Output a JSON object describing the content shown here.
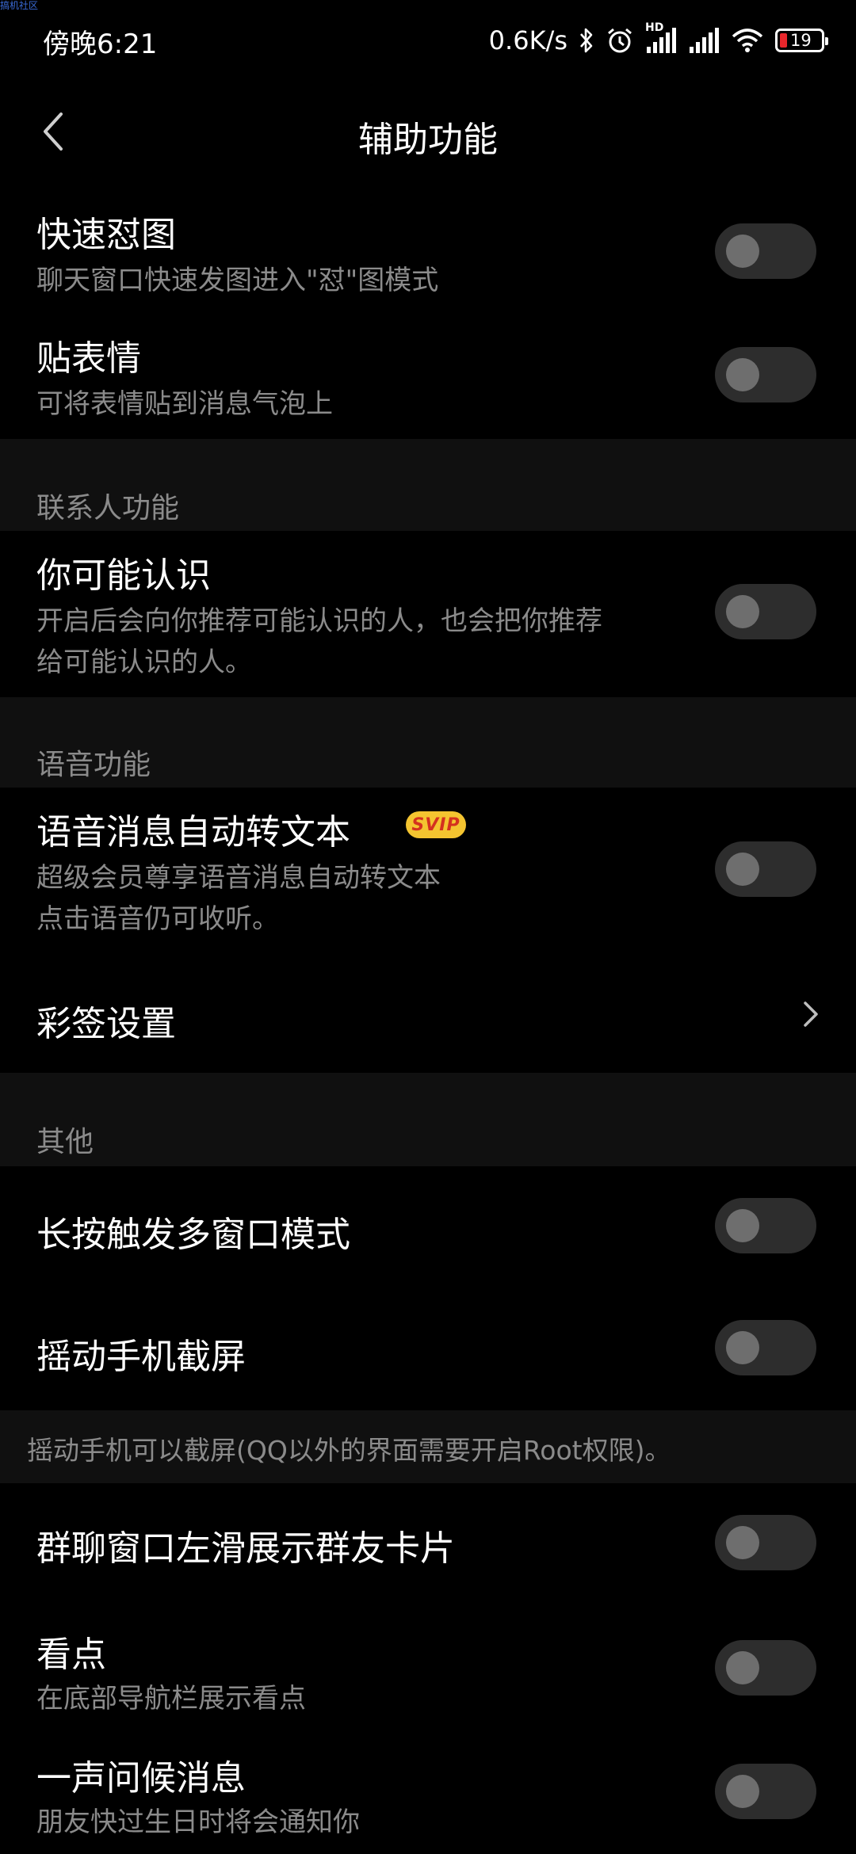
{
  "watermark": "搞机社区",
  "status_bar": {
    "time": "傍晚6:21",
    "net_speed": "0.6K/s",
    "hd_label": "HD",
    "battery_level": "19",
    "icons": [
      "bluetooth-icon",
      "alarm-icon",
      "signal-hd-icon",
      "signal-icon",
      "wifi-icon",
      "battery-icon"
    ]
  },
  "header": {
    "title": "辅助功能",
    "back_icon": "chevron-left-icon"
  },
  "sections": {
    "contacts_header": "联系人功能",
    "voice_header": "语音功能",
    "other_header": "其他"
  },
  "items": {
    "quick_pic": {
      "title": "快速怼图",
      "desc": "聊天窗口快速发图进入\"怼\"图模式",
      "enabled": false
    },
    "sticker": {
      "title": "贴表情",
      "desc": "可将表情贴到消息气泡上",
      "enabled": false
    },
    "may_know": {
      "title": "你可能认识",
      "desc_line1": "开启后会向你推荐可能认识的人，也会把你推荐",
      "desc_line2": "给可能认识的人。",
      "enabled": false
    },
    "voice_to_text": {
      "title": "语音消息自动转文本",
      "badge": "SVIP",
      "desc_line1": "超级会员尊享语音消息自动转文本",
      "desc_line2": "点击语音仍可收听。",
      "enabled": false
    },
    "color_sign": {
      "title": "彩签设置"
    },
    "multi_window": {
      "title": "长按触发多窗口模式",
      "enabled": false
    },
    "shake_screenshot": {
      "title": "摇动手机截屏",
      "enabled": false
    },
    "shake_note": "摇动手机可以截屏(QQ以外的界面需要开启Root权限)。",
    "group_swipe": {
      "title": "群聊窗口左滑展示群友卡片",
      "enabled": false
    },
    "kandian": {
      "title": "看点",
      "desc": "在底部导航栏展示看点",
      "enabled": false
    },
    "greeting": {
      "title": "一声问候消息",
      "desc": "朋友快过生日时将会通知你",
      "enabled": false
    }
  },
  "colors": {
    "background": "#000000",
    "section_gap": "#101010",
    "toggle_track": "#2d2d2d",
    "toggle_knob": "#6e6e6e",
    "secondary_text": "#8b8b8b",
    "svip_badge": "#f4c430"
  }
}
